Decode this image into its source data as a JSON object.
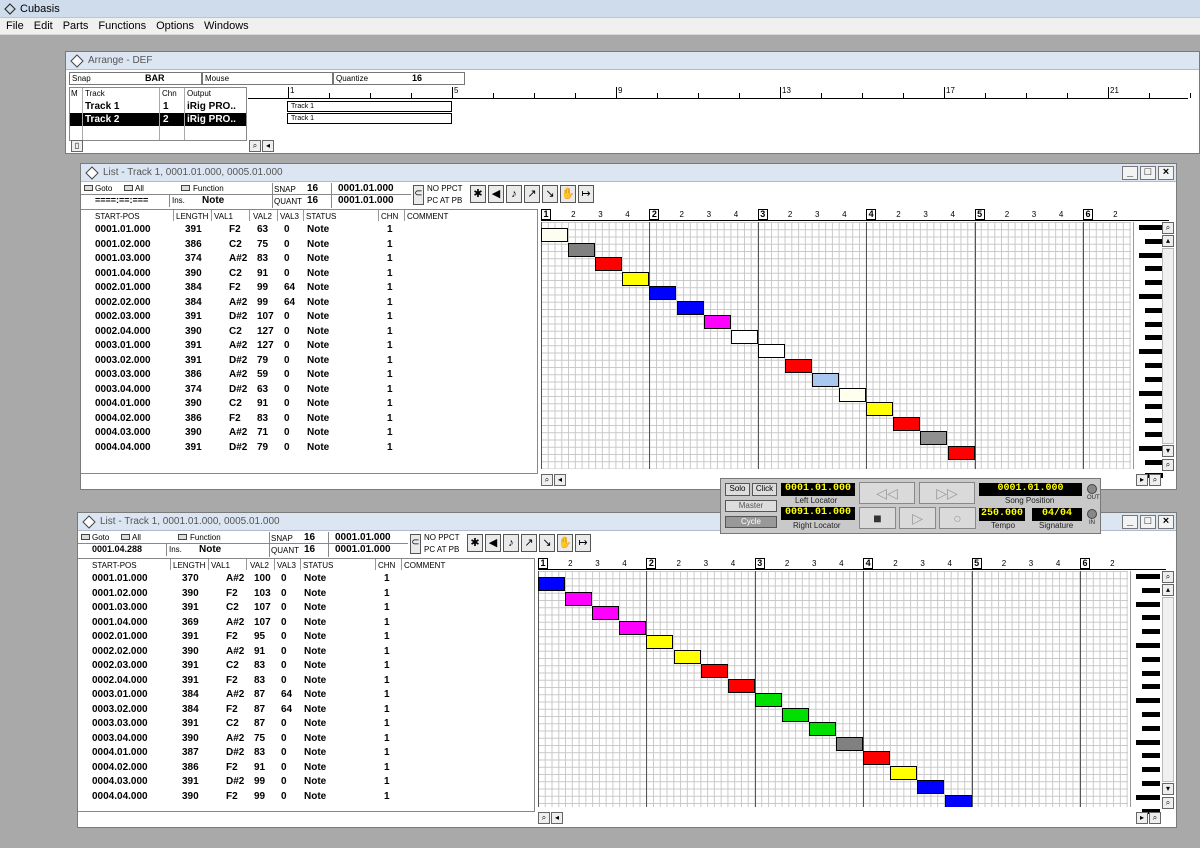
{
  "app": {
    "title": "Cubasis"
  },
  "menu": [
    "File",
    "Edit",
    "Parts",
    "Functions",
    "Options",
    "Windows"
  ],
  "arrange": {
    "title": "Arrange - DEF",
    "snap_label": "Snap",
    "snap_value": "BAR",
    "mouse_label": "Mouse",
    "quantize_label": "Quantize",
    "quantize_value": "16",
    "headers": {
      "m": "M",
      "track": "Track",
      "chn": "Chn",
      "output": "Output"
    },
    "tracks": [
      {
        "name": "Track 1",
        "chn": "1",
        "output": "iRig PRO.."
      },
      {
        "name": "Track 2",
        "chn": "2",
        "output": "iRig PRO.."
      }
    ],
    "ruler": [
      "1",
      "5",
      "9",
      "13",
      "17",
      "21"
    ],
    "parts": [
      "Track 1",
      "Track 1"
    ]
  },
  "lists": [
    {
      "title": "List - Track 1, 0001.01.000, 0005.01.000",
      "goto": "Goto",
      "all": "All",
      "function": "Function",
      "pos": "====:==:===",
      "ins": "Ins.",
      "insval": "Note",
      "snap_label": "SNAP",
      "snap": "16",
      "snappos": "0001.01.000",
      "quant_label": "QUANT",
      "quant": "16",
      "quantpos": "0001.01.000",
      "noppct": "NO PPCT",
      "pcatpb": "PC AT PB",
      "headers": [
        "START-POS",
        "LENGTH",
        "VAL1",
        "VAL2",
        "VAL3",
        "STATUS",
        "CHN",
        "COMMENT"
      ],
      "rows": [
        [
          "0001.01.000",
          "391",
          "F2",
          "63",
          "0",
          "Note",
          "1"
        ],
        [
          "0001.02.000",
          "386",
          "C2",
          "75",
          "0",
          "Note",
          "1"
        ],
        [
          "0001.03.000",
          "374",
          "A#2",
          "83",
          "0",
          "Note",
          "1"
        ],
        [
          "0001.04.000",
          "390",
          "C2",
          "91",
          "0",
          "Note",
          "1"
        ],
        [
          "0002.01.000",
          "384",
          "F2",
          "99",
          "64",
          "Note",
          "1"
        ],
        [
          "0002.02.000",
          "384",
          "A#2",
          "99",
          "64",
          "Note",
          "1"
        ],
        [
          "0002.03.000",
          "391",
          "D#2",
          "107",
          "0",
          "Note",
          "1"
        ],
        [
          "0002.04.000",
          "390",
          "C2",
          "127",
          "0",
          "Note",
          "1"
        ],
        [
          "0003.01.000",
          "391",
          "A#2",
          "127",
          "0",
          "Note",
          "1"
        ],
        [
          "0003.02.000",
          "391",
          "D#2",
          "79",
          "0",
          "Note",
          "1"
        ],
        [
          "0003.03.000",
          "386",
          "A#2",
          "59",
          "0",
          "Note",
          "1"
        ],
        [
          "0003.04.000",
          "374",
          "D#2",
          "63",
          "0",
          "Note",
          "1"
        ],
        [
          "0004.01.000",
          "390",
          "C2",
          "91",
          "0",
          "Note",
          "1"
        ],
        [
          "0004.02.000",
          "386",
          "F2",
          "83",
          "0",
          "Note",
          "1"
        ],
        [
          "0004.03.000",
          "390",
          "A#2",
          "71",
          "0",
          "Note",
          "1"
        ],
        [
          "0004.04.000",
          "391",
          "D#2",
          "79",
          "0",
          "Note",
          "1"
        ]
      ],
      "ruler": [
        "1",
        "2",
        "3",
        "4",
        "2",
        "2",
        "3",
        "4",
        "3",
        "2",
        "3",
        "4",
        "4",
        "2",
        "3",
        "4",
        "5",
        "2",
        "3",
        "4",
        "6",
        "2"
      ],
      "colors": [
        "#fdfdf0",
        "#808080",
        "#ff0000",
        "#ffff00",
        "#0000ff",
        "#0000ff",
        "#ff00ff",
        "#ffffff",
        "#ffffff",
        "#ff0000",
        "#a8c8f0",
        "#fffff0",
        "#ffff00",
        "#ff0000",
        "#909090",
        "#ff0000"
      ]
    },
    {
      "title": "List - Track 1, 0001.01.000, 0005.01.000",
      "goto": "Goto",
      "all": "All",
      "function": "Function",
      "pos": "0001.04.288",
      "ins": "Ins.",
      "insval": "Note",
      "snap_label": "SNAP",
      "snap": "16",
      "snappos": "0001.01.000",
      "quant_label": "QUANT",
      "quant": "16",
      "quantpos": "0001.01.000",
      "noppct": "NO PPCT",
      "pcatpb": "PC AT PB",
      "headers": [
        "START-POS",
        "LENGTH",
        "VAL1",
        "VAL2",
        "VAL3",
        "STATUS",
        "CHN",
        "COMMENT"
      ],
      "rows": [
        [
          "0001.01.000",
          "370",
          "A#2",
          "100",
          "0",
          "Note",
          "1"
        ],
        [
          "0001.02.000",
          "390",
          "F2",
          "103",
          "0",
          "Note",
          "1"
        ],
        [
          "0001.03.000",
          "391",
          "C2",
          "107",
          "0",
          "Note",
          "1"
        ],
        [
          "0001.04.000",
          "369",
          "A#2",
          "107",
          "0",
          "Note",
          "1"
        ],
        [
          "0002.01.000",
          "391",
          "F2",
          "95",
          "0",
          "Note",
          "1"
        ],
        [
          "0002.02.000",
          "390",
          "A#2",
          "91",
          "0",
          "Note",
          "1"
        ],
        [
          "0002.03.000",
          "391",
          "C2",
          "83",
          "0",
          "Note",
          "1"
        ],
        [
          "0002.04.000",
          "391",
          "F2",
          "83",
          "0",
          "Note",
          "1"
        ],
        [
          "0003.01.000",
          "384",
          "A#2",
          "87",
          "64",
          "Note",
          "1"
        ],
        [
          "0003.02.000",
          "384",
          "F2",
          "87",
          "64",
          "Note",
          "1"
        ],
        [
          "0003.03.000",
          "391",
          "C2",
          "87",
          "0",
          "Note",
          "1"
        ],
        [
          "0003.04.000",
          "390",
          "A#2",
          "75",
          "0",
          "Note",
          "1"
        ],
        [
          "0004.01.000",
          "387",
          "D#2",
          "83",
          "0",
          "Note",
          "1"
        ],
        [
          "0004.02.000",
          "386",
          "F2",
          "91",
          "0",
          "Note",
          "1"
        ],
        [
          "0004.03.000",
          "391",
          "D#2",
          "99",
          "0",
          "Note",
          "1"
        ],
        [
          "0004.04.000",
          "390",
          "F2",
          "99",
          "0",
          "Note",
          "1"
        ]
      ],
      "ruler": [
        "1",
        "2",
        "3",
        "4",
        "2",
        "2",
        "3",
        "4",
        "3",
        "2",
        "3",
        "4",
        "4",
        "2",
        "3",
        "4",
        "5",
        "2",
        "3",
        "4",
        "6",
        "2"
      ],
      "colors": [
        "#0000ff",
        "#ff00ff",
        "#ff00ff",
        "#ff00ff",
        "#ffff00",
        "#ffff00",
        "#ff0000",
        "#ff0000",
        "#00e000",
        "#00e000",
        "#00e000",
        "#808080",
        "#ff0000",
        "#ffff00",
        "#0000ff",
        "#0000ff"
      ]
    }
  ],
  "transport": {
    "solo": "Solo",
    "click": "Click",
    "master": "Master",
    "cycle": "Cycle",
    "left_locator": "0001.01.000",
    "left_label": "Left Locator",
    "right_locator": "0091.01.000",
    "right_label": "Right Locator",
    "song_position": "0001.01.000",
    "song_label": "Song Position",
    "tempo": "250.000",
    "tempo_label": "Tempo",
    "signature": "04/04",
    "signature_label": "Signature",
    "out": "OUT",
    "in": "IN"
  }
}
